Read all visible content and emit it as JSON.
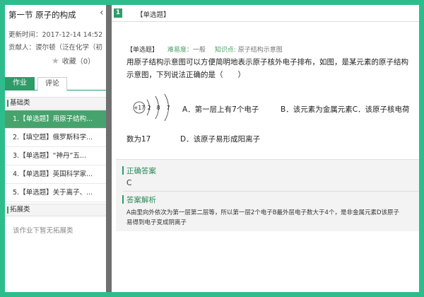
{
  "lesson": {
    "title": "第一节 原子的构成",
    "collapse_icon": "chevron-left-icon",
    "updated": "更新时间：2017-12-14 14:52",
    "author": "贡献人：谡尔顿（泛在化学（初",
    "favorite_label": "收藏（0）"
  },
  "tabs": [
    {
      "label": "作业",
      "active": true
    },
    {
      "label": "评论",
      "active": false
    }
  ],
  "sections": {
    "basic": "基础类",
    "extended": "拓展类",
    "extended_empty": "该作业下暂无拓展类"
  },
  "items": [
    {
      "label": "1.【单选题】用原子结构...",
      "active": true
    },
    {
      "label": "2.【填空题】俄罗斯科学...",
      "active": false
    },
    {
      "label": "3.【单选题】“神丹”五...",
      "active": false
    },
    {
      "label": "4.【单选题】英国科学家...",
      "active": false
    },
    {
      "label": "5.【单选题】关于离子、...",
      "active": false
    }
  ],
  "question": {
    "number": "1",
    "type_top": "【单选题】",
    "type_tag": "【单选题】",
    "difficulty_label": "难易度：",
    "difficulty": "一般",
    "knowledge_label": "知识点:",
    "knowledge": "原子结构示意图",
    "stem_line1": "用原子结构示意图可以方便简明地表示原子核外电子排布，如图，是某元素的原子结构",
    "stem_line2": "示意图，下列说法正确的是（　　）",
    "atom": {
      "nucleus": "+17",
      "shells": [
        "2",
        "8",
        "7"
      ]
    },
    "option_a": "A．第一层上有7个电子",
    "option_b": "B．该元素为金属元素C．该原子核电荷",
    "option_b_cont": "数为17",
    "option_d": "D．该原子易形成阳离子"
  },
  "answer": {
    "title": "正确答案",
    "value": "C"
  },
  "explanation": {
    "title": "答案解析",
    "line1": "A由里向外依次为第一层第二层等，所以第一层2个电子B最外层电子数大于4个，是非金属元素D该原子",
    "line2": "易得到电子变成阴离子"
  },
  "colors": {
    "frame_border": "#2dbd8c",
    "accent_green": "#2e9c68",
    "active_item": "#46a36d",
    "divider": "#6f6f6f"
  }
}
